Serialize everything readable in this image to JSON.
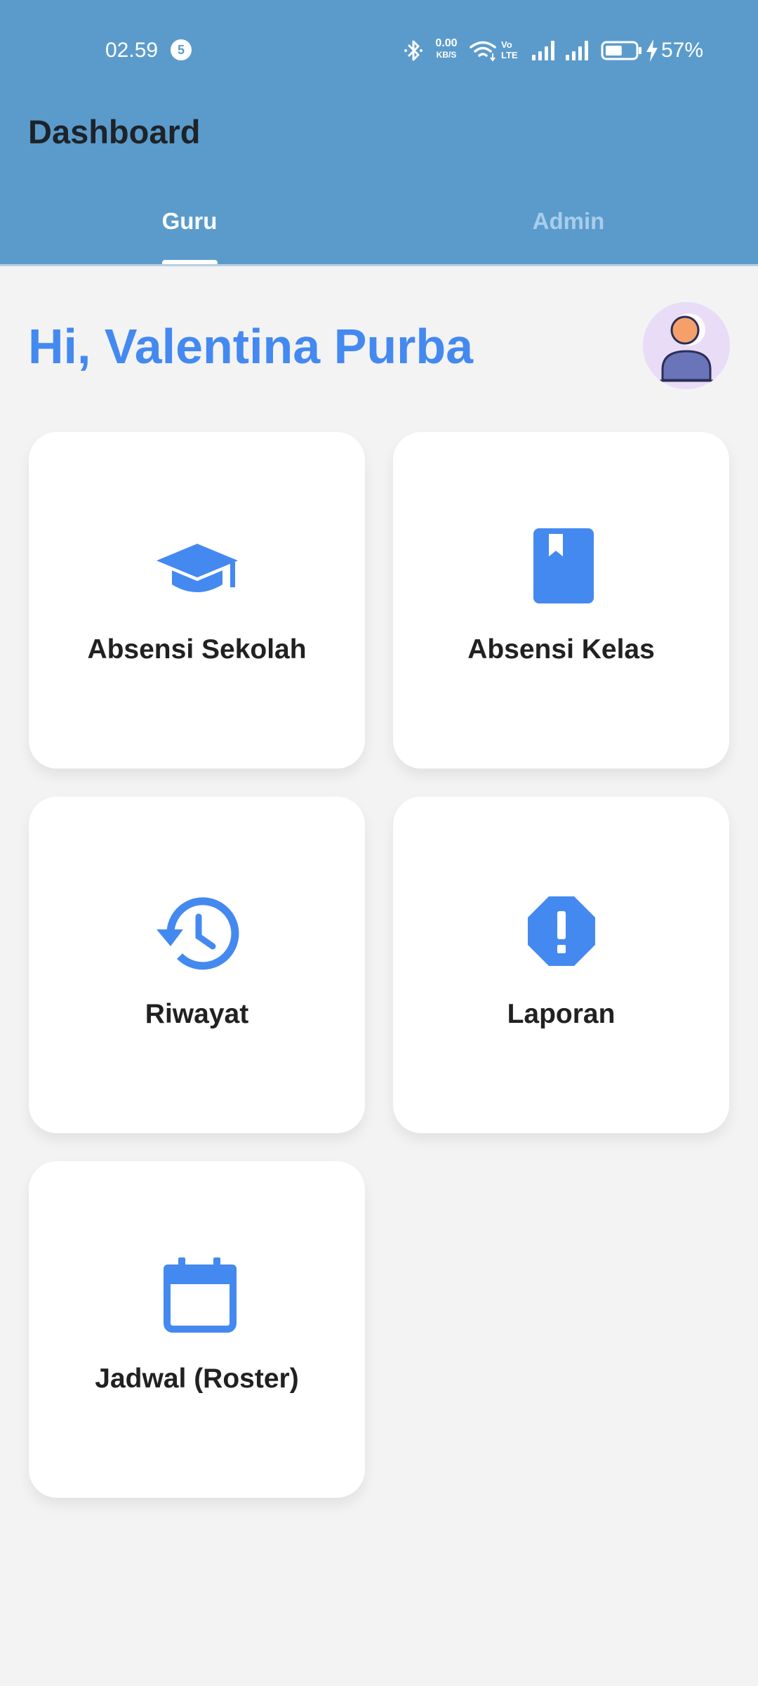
{
  "status_bar": {
    "time": "02.59",
    "notification_count": "5",
    "net_speed_value": "0.00",
    "net_speed_unit": "KB/S",
    "volte_top": "Vo",
    "volte_bottom": "LTE",
    "battery_percent": "57%",
    "battery_level": 0.57,
    "icons": [
      "bluetooth-icon",
      "wifi-icon",
      "signal-1-icon",
      "signal-2-icon",
      "battery-icon",
      "charging-bolt-icon"
    ]
  },
  "header": {
    "title": "Dashboard",
    "tabs": [
      {
        "label": "Guru",
        "selected": true
      },
      {
        "label": "Admin",
        "selected": false
      }
    ]
  },
  "greeting": {
    "text": "Hi, Valentina Purba"
  },
  "menu": {
    "items": [
      {
        "label": "Absensi Sekolah",
        "icon": "graduation-cap-icon"
      },
      {
        "label": "Absensi Kelas",
        "icon": "book-icon"
      },
      {
        "label": "Riwayat",
        "icon": "history-icon"
      },
      {
        "label": "Laporan",
        "icon": "report-alert-icon"
      },
      {
        "label": "Jadwal (Roster)",
        "icon": "calendar-icon"
      }
    ]
  },
  "colors": {
    "appbar": "#5b9bcc",
    "accent": "#4489f0",
    "background": "#f3f3f4",
    "card": "#ffffff",
    "avatar_bg": "#e8dcf7"
  }
}
